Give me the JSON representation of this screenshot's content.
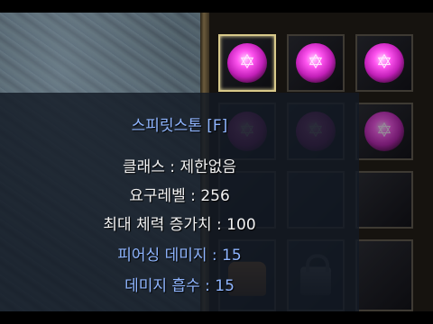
{
  "tooltip": {
    "title": "스피릿스톤 [F]",
    "lines": [
      {
        "text": "클래스 : 제한없음",
        "color": "#f2f2f2"
      },
      {
        "text": "요구레벨 : 256",
        "color": "#f2f2f2"
      },
      {
        "text": "최대 체력 증가치 : 100",
        "color": "#f2f2f2"
      },
      {
        "text": "피어싱 데미지 : 15",
        "color": "#8fb5ff"
      },
      {
        "text": "데미지 흡수 : 15",
        "color": "#8fb5ff"
      }
    ]
  },
  "inventory": {
    "slots": [
      {
        "item": "spirit-stone",
        "selected": true
      },
      {
        "item": "spirit-stone",
        "selected": false
      },
      {
        "item": "spirit-stone",
        "selected": false
      },
      {
        "item": "spirit-stone",
        "selected": false
      },
      {
        "item": "spirit-stone",
        "selected": false
      },
      {
        "item": "spirit-stone",
        "selected": false
      },
      {
        "item": "empty",
        "selected": false
      },
      {
        "item": "empty",
        "selected": false
      },
      {
        "item": "empty",
        "selected": false
      },
      {
        "item": "leather-bag",
        "selected": false
      },
      {
        "item": "lock",
        "selected": false
      },
      {
        "item": "empty",
        "selected": false
      }
    ]
  },
  "colors": {
    "title": "#8fb5ff",
    "stat_white": "#f2f2f2",
    "stat_blue": "#8fb5ff",
    "selected_border": "#d8c98a",
    "gem": "#ff55f0"
  },
  "icons": {
    "gem_glyph": "✡"
  }
}
